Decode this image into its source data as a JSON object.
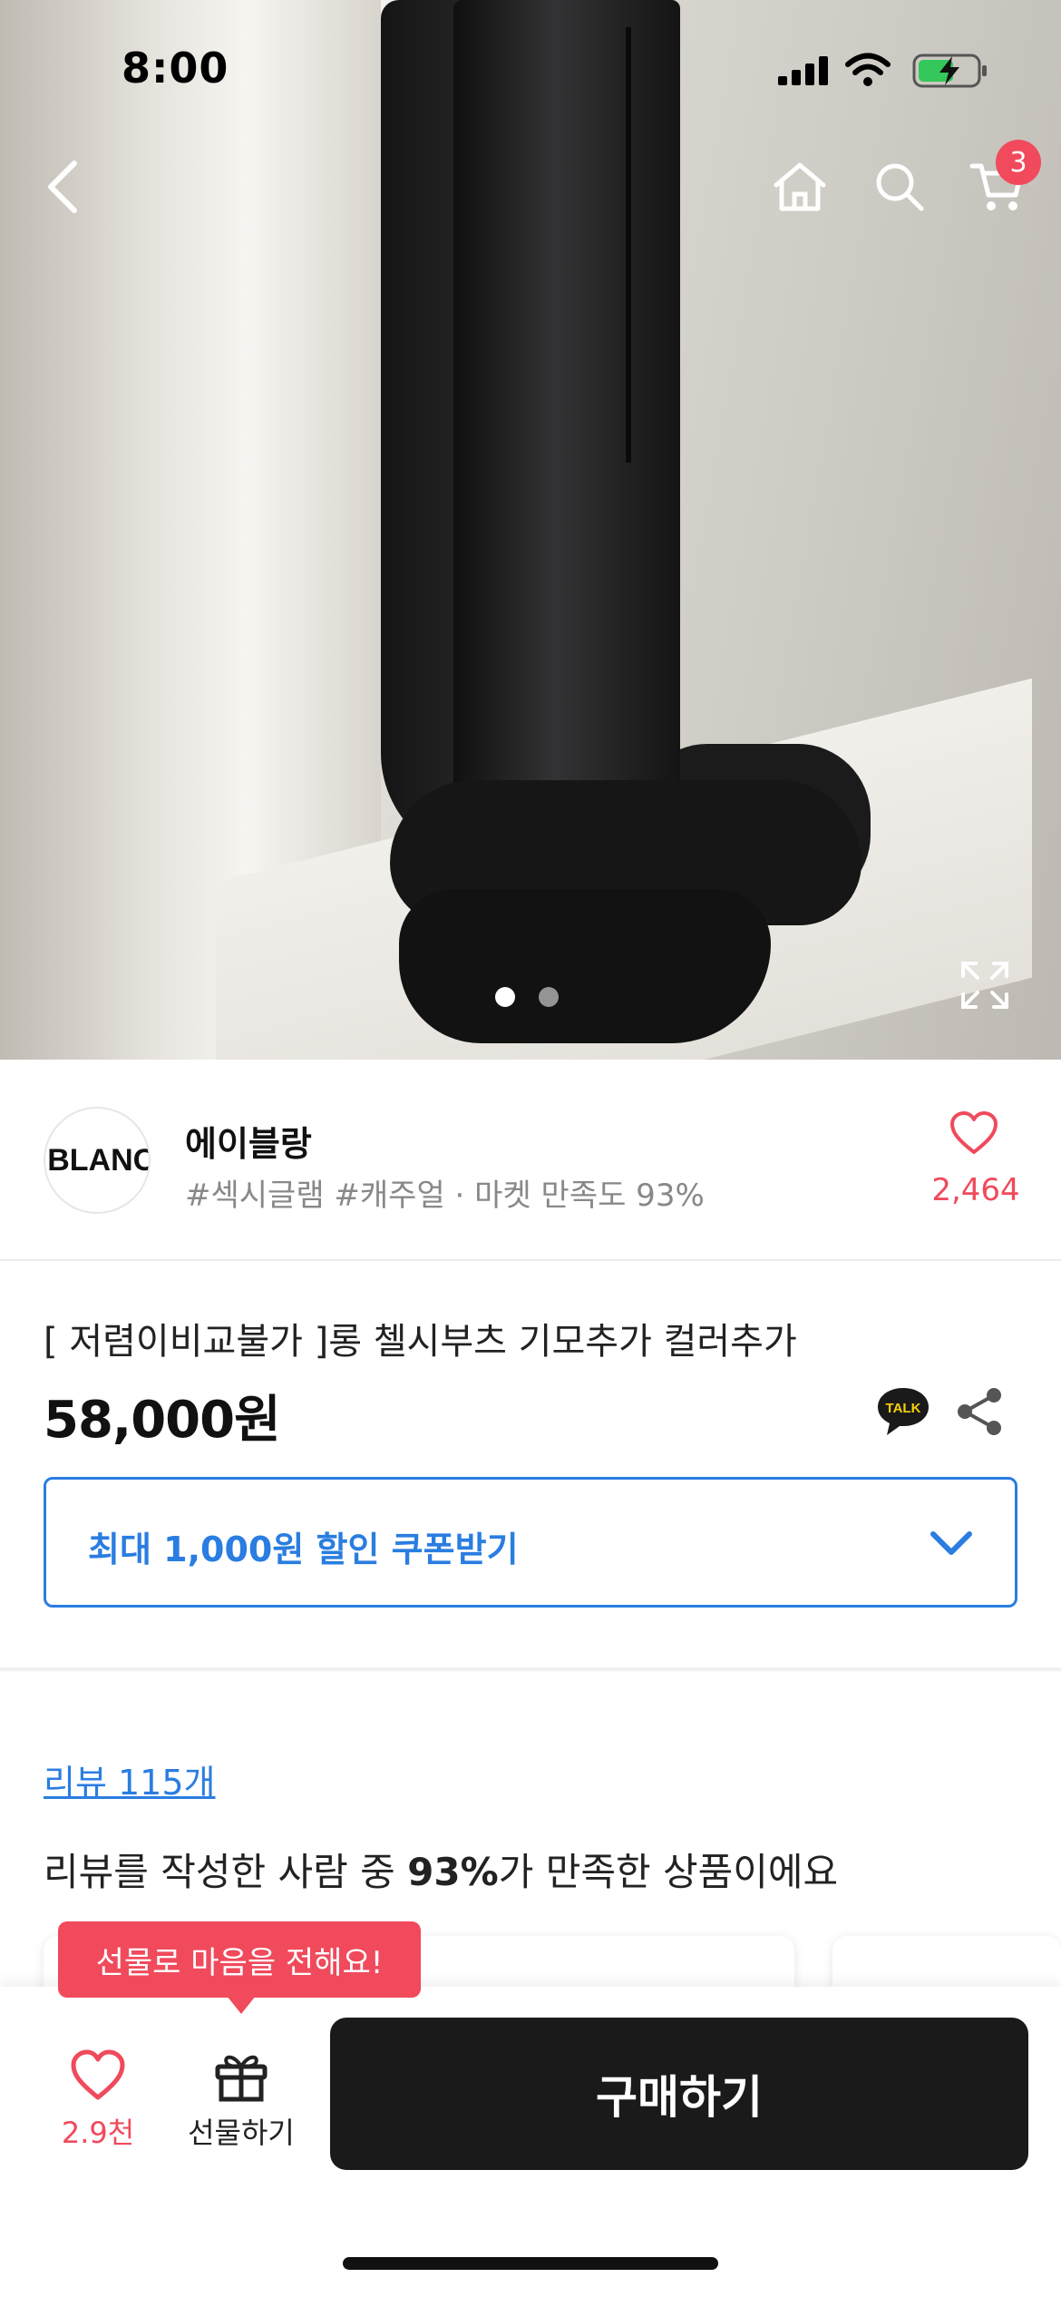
{
  "status_bar": {
    "time": "8:00"
  },
  "nav": {
    "cart_count": "3"
  },
  "seller": {
    "logo_text": ".BLANC",
    "name": "에이블랑",
    "tags": "#섹시글램 #캐주얼 · 마켓 만족도 93%",
    "likes": "2,464"
  },
  "product": {
    "title": "[ 저렴이비교불가 ]롱 첼시부츠 기모추가 컬러추가",
    "price": "58,000원",
    "talk_label": "TALK"
  },
  "coupon": {
    "label": "최대 1,000원 할인 쿠폰받기"
  },
  "reviews": {
    "count_label": "리뷰 115개",
    "summary_prefix": "리뷰를 작성한 사람 중 ",
    "summary_percent": "93%",
    "summary_suffix": "가 만족한 상품이에요"
  },
  "tooltip": {
    "text": "선물로 마음을 전해요!"
  },
  "bottom_bar": {
    "wish_count": "2.9천",
    "gift_label": "선물하기",
    "buy_label": "구매하기"
  },
  "colors": {
    "accent": "#f04a5c",
    "link": "#2a7de1",
    "buy_bg": "#1a1a1a"
  },
  "image_carousel": {
    "total": 2,
    "current": 1
  }
}
